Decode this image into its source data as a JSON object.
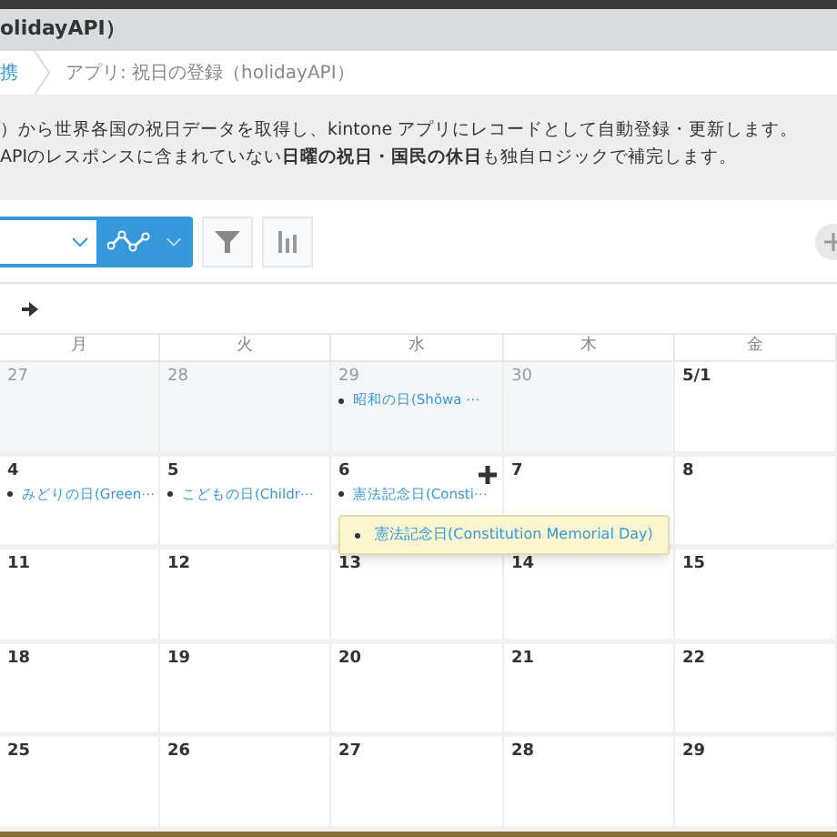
{
  "header": {
    "title": "olidayAPI）"
  },
  "breadcrumb": [
    {
      "label": "携",
      "kind": "link"
    },
    {
      "label": "アプリ: 祝日の登録（holidayAPI）",
      "kind": "text"
    }
  ],
  "description": [
    "）から世界各国の祝日データを取得し、kintone アプリにレコードとして自動登録・更新します。",
    "APIのレスポンスに含まれていない**日曜の祝日・国民の休日**も独自ロジックで補完します。"
  ],
  "weekdays": [
    "月",
    "火",
    "水",
    "木",
    "金"
  ],
  "weeks": [
    {
      "days": [
        {
          "date": "27",
          "muted": true
        },
        {
          "date": "28",
          "muted": true
        },
        {
          "date": "29",
          "muted": true,
          "events": [
            "昭和の日(Shōwa ⋯"
          ]
        },
        {
          "date": "30",
          "muted": true
        },
        {
          "date": "5/1",
          "muted": false
        }
      ]
    },
    {
      "days": [
        {
          "date": "4",
          "muted": false,
          "events": [
            "みどりの日(Green⋯"
          ]
        },
        {
          "date": "5",
          "muted": false,
          "events": [
            "こどもの日(Childr⋯"
          ]
        },
        {
          "date": "6",
          "muted": false,
          "events": [
            "憲法記念日(Consti⋯"
          ],
          "hover": true
        },
        {
          "date": "7",
          "muted": false
        },
        {
          "date": "8",
          "muted": false
        }
      ]
    },
    {
      "days": [
        {
          "date": "11",
          "muted": false
        },
        {
          "date": "12",
          "muted": false
        },
        {
          "date": "13",
          "muted": false
        },
        {
          "date": "14",
          "muted": false
        },
        {
          "date": "15",
          "muted": false
        }
      ]
    },
    {
      "days": [
        {
          "date": "18",
          "muted": false
        },
        {
          "date": "19",
          "muted": false
        },
        {
          "date": "20",
          "muted": false
        },
        {
          "date": "21",
          "muted": false
        },
        {
          "date": "22",
          "muted": false
        }
      ]
    },
    {
      "days": [
        {
          "date": "25",
          "muted": false
        },
        {
          "date": "26",
          "muted": false
        },
        {
          "date": "27",
          "muted": false
        },
        {
          "date": "28",
          "muted": false
        },
        {
          "date": "29",
          "muted": false
        }
      ]
    }
  ],
  "tooltip": {
    "text": "憲法記念日(Constitution Memorial Day)"
  }
}
